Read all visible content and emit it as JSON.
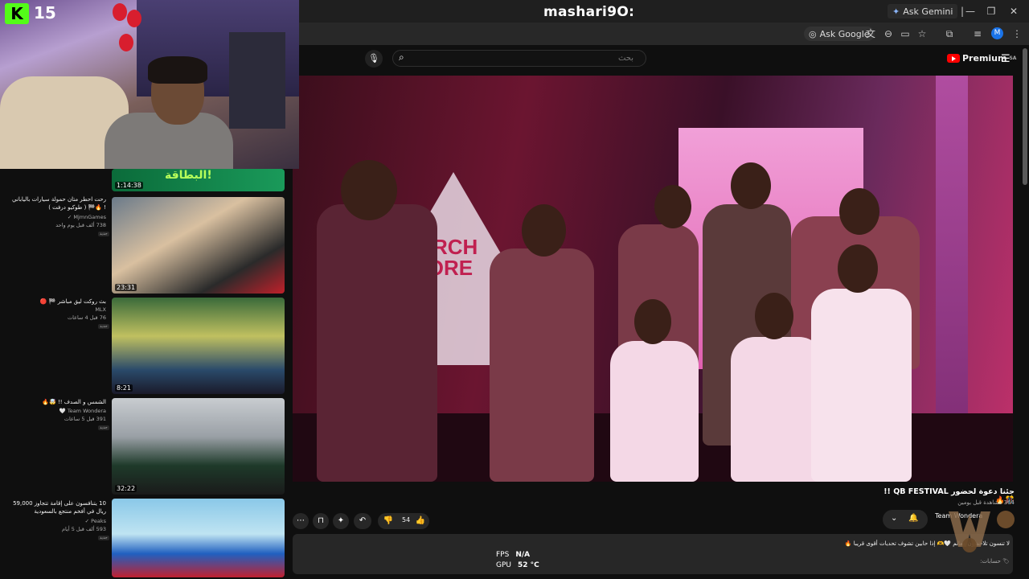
{
  "window": {
    "title": "mashari9O:",
    "ask_gemini": "Ask Gemini",
    "minimize": "—",
    "restore": "❐",
    "close": "✕"
  },
  "browser": {
    "ask_google": "Ask Google",
    "profile_initial": "M"
  },
  "stream": {
    "viewer_count": "15",
    "kick_letter": "K"
  },
  "youtube": {
    "search_placeholder": "بحث",
    "premium_label": "Premium",
    "premium_region": "SA"
  },
  "video": {
    "store_line1": "MERCH",
    "store_line2": "STORE",
    "title": "جئنا دعوة لحضور QB FESTIVAL !! 🎊🔥",
    "views": "364 مشاهدة  قبل يومين",
    "likes": "54",
    "channel_name": "Team Wondera",
    "description_line1": "لا تنسون تلاحظون معالم 🤍🫶 إذا حابين تشوف تحديات أقوى قريبا 🔥",
    "description_line2": "🏷 حسابات:"
  },
  "related": [
    {
      "duration": "1:14:38",
      "title": "",
      "channel": "",
      "meta": "",
      "thumb_text": "البطاقة!"
    },
    {
      "duration": "23:31",
      "title": "رحت احطر متان حمولة سيارات بالياباني ! 🔥🏁 ( طوكيو درفت )",
      "channel": "MjmnGames ✓",
      "meta": "738 ألف  قبل يوم واحد",
      "badge": "جديد"
    },
    {
      "duration": "8:21",
      "title": "بث روكت ليق مباشر 🏁 🔴",
      "channel": "MLX",
      "meta": "76  قبل 4 ساعات",
      "badge": "جديد"
    },
    {
      "duration": "32:22",
      "title": "الشمس و الصدف !! 🤯🔥",
      "channel": "Team Wondera 🤍",
      "meta": "391  قبل 5 ساعات",
      "badge": "جديد"
    },
    {
      "duration": "",
      "title": "10 يتنافسون على إقامة تتجاوز 59,000 ريال في أفخم منتجع بالسعودية",
      "channel": "Peaks ✓",
      "meta": "593 ألف  قبل 5 أيام",
      "badge": "جديد"
    }
  ],
  "overlay": {
    "fps_label": "FPS",
    "fps_value": "N/A",
    "gpu_label": "GPU",
    "gpu_value": "52 °C"
  },
  "colors": {
    "kick_green": "#53fc18",
    "youtube_red": "#ff0000",
    "background": "#0f0f0f"
  }
}
